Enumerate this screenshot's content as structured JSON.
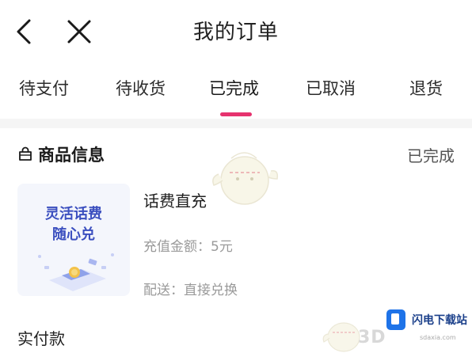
{
  "header": {
    "title": "我的订单",
    "back_icon": "chevron-left-icon",
    "close_icon": "close-icon"
  },
  "tabs": [
    {
      "label": "待支付",
      "active": false
    },
    {
      "label": "待收货",
      "active": false
    },
    {
      "label": "已完成",
      "active": true
    },
    {
      "label": "已取消",
      "active": false
    },
    {
      "label": "退货",
      "active": false
    }
  ],
  "colors": {
    "accent": "#e6326e",
    "thumb_text": "#3b4fbf",
    "muted_text": "#9a9a9a"
  },
  "order": {
    "section_title": "商品信息",
    "section_icon": "shopping-bag-icon",
    "status": "已完成",
    "thumbnail": {
      "line1": "灵活话费",
      "line2": "随心兑"
    },
    "product_name": "话费直充",
    "recharge_amount": "充值金额：5元",
    "delivery": "配送：直接兑换",
    "paid_label": "实付款"
  },
  "watermark": {
    "brand": "闪电下载站",
    "site_mark": "3D",
    "url": "sdaxia.com"
  }
}
